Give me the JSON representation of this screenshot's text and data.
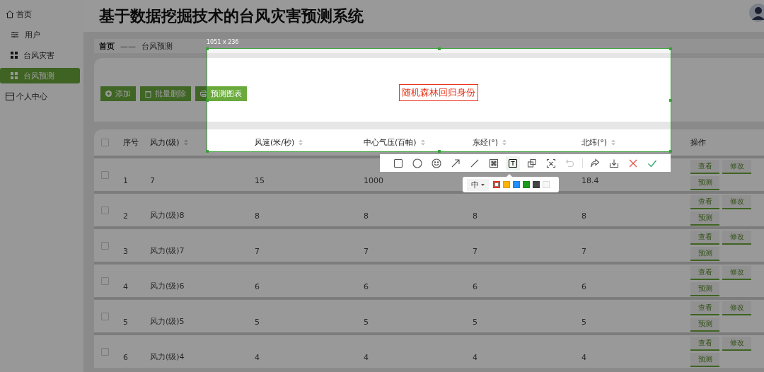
{
  "sidebar": {
    "items": [
      {
        "label": "首页",
        "selected": false
      },
      {
        "label": "用户",
        "selected": false
      },
      {
        "label": "台风灾害",
        "selected": false
      },
      {
        "label": "台风预测",
        "selected": true
      },
      {
        "label": "个人中心",
        "selected": false
      }
    ]
  },
  "title": "基于数据挖掘技术的台风灾害预测系统",
  "breadcrumb": {
    "items": [
      "首页",
      "台风预测"
    ],
    "separator": "——"
  },
  "actions": [
    "添加",
    "批量删除",
    "预测图表"
  ],
  "table": {
    "select_all": {
      "checked": false
    },
    "columns": [
      {
        "label": "序号",
        "sortable": false
      },
      {
        "label": "风力(级)",
        "sortable": true
      },
      {
        "label": "风速(米/秒)",
        "sortable": true
      },
      {
        "label": "中心气压(百帕)",
        "sortable": true
      },
      {
        "label": "东经(°)",
        "sortable": true
      },
      {
        "label": "北纬(°)",
        "sortable": true
      },
      {
        "label": "操作",
        "sortable": false
      }
    ],
    "rows": [
      {
        "checked": false,
        "cells": [
          "1",
          "7",
          "15",
          "1000",
          null,
          "18.4"
        ],
        "actions": [
          "查看",
          "修改",
          "预测"
        ]
      },
      {
        "checked": false,
        "cells": [
          "2",
          "风力(级)8",
          "8",
          "8",
          "8",
          "8"
        ],
        "actions": [
          "查看",
          "修改",
          "预测"
        ]
      },
      {
        "checked": false,
        "cells": [
          "3",
          "风力(级)7",
          "7",
          "7",
          "7",
          "7"
        ],
        "actions": [
          "查看",
          "修改",
          "预测"
        ]
      },
      {
        "checked": false,
        "cells": [
          "4",
          "风力(级)6",
          "6",
          "6",
          "6",
          "6"
        ],
        "actions": [
          "查看",
          "修改",
          "预测"
        ]
      },
      {
        "checked": false,
        "cells": [
          "5",
          "风力(级)5",
          "5",
          "5",
          "5",
          "5"
        ],
        "actions": [
          "查看",
          "修改",
          "预测"
        ]
      },
      {
        "checked": false,
        "cells": [
          "6",
          "风力(级)4",
          "4",
          "4",
          "4",
          "4"
        ],
        "actions": [
          "查看",
          "修改",
          "预测"
        ]
      }
    ]
  },
  "capture": {
    "size_label": "1051 x 236",
    "annotation": "随机森林回归身份",
    "tools": [
      {
        "kind": "rectangle",
        "selected": false,
        "disabled": false
      },
      {
        "kind": "ellipse",
        "selected": false,
        "disabled": false
      },
      {
        "kind": "emoji",
        "selected": false,
        "disabled": false
      },
      {
        "kind": "arrow",
        "selected": false,
        "disabled": false
      },
      {
        "kind": "line",
        "selected": false,
        "disabled": false
      },
      {
        "kind": "mosaic",
        "selected": false,
        "disabled": false
      },
      {
        "kind": "text",
        "selected": true,
        "disabled": false
      },
      {
        "kind": "pin",
        "selected": false,
        "disabled": false
      },
      {
        "kind": "ocr",
        "selected": false,
        "disabled": false
      },
      {
        "kind": "undo",
        "selected": false,
        "disabled": true
      },
      {
        "kind": "share",
        "selected": false,
        "disabled": false
      },
      {
        "kind": "save",
        "selected": false,
        "disabled": false
      },
      {
        "kind": "cancel",
        "selected": false,
        "disabled": false
      },
      {
        "kind": "confirm",
        "selected": false,
        "disabled": false
      }
    ],
    "font_size": "中",
    "colors": [
      {
        "color": "#e8341c",
        "selected": true
      },
      {
        "color": "#ffb400",
        "selected": false
      },
      {
        "color": "#1e90ff",
        "selected": false
      },
      {
        "color": "#1a9a1a",
        "selected": false
      },
      {
        "color": "#444444",
        "selected": false
      },
      {
        "color": "#f7f7f7",
        "selected": false
      }
    ]
  }
}
